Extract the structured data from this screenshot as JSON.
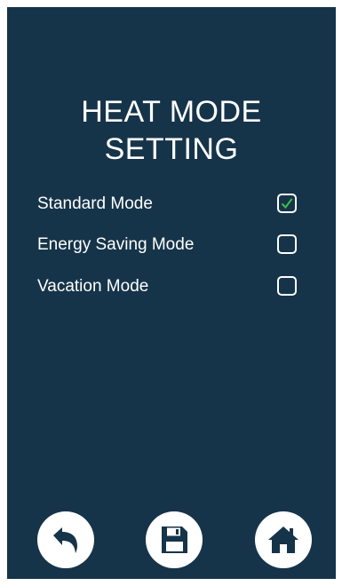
{
  "title": {
    "line1": "HEAT MODE",
    "line2": "SETTING"
  },
  "modes": [
    {
      "label": "Standard Mode",
      "checked": true
    },
    {
      "label": "Energy Saving Mode",
      "checked": false
    },
    {
      "label": "Vacation Mode",
      "checked": false
    }
  ],
  "nav": {
    "back_icon": "back-arrow-icon",
    "save_icon": "floppy-disk-icon",
    "home_icon": "home-icon"
  },
  "colors": {
    "background": "#163449",
    "text": "#ffffff",
    "check": "#3fbf4a",
    "button": "#ffffff",
    "icon": "#163449"
  }
}
